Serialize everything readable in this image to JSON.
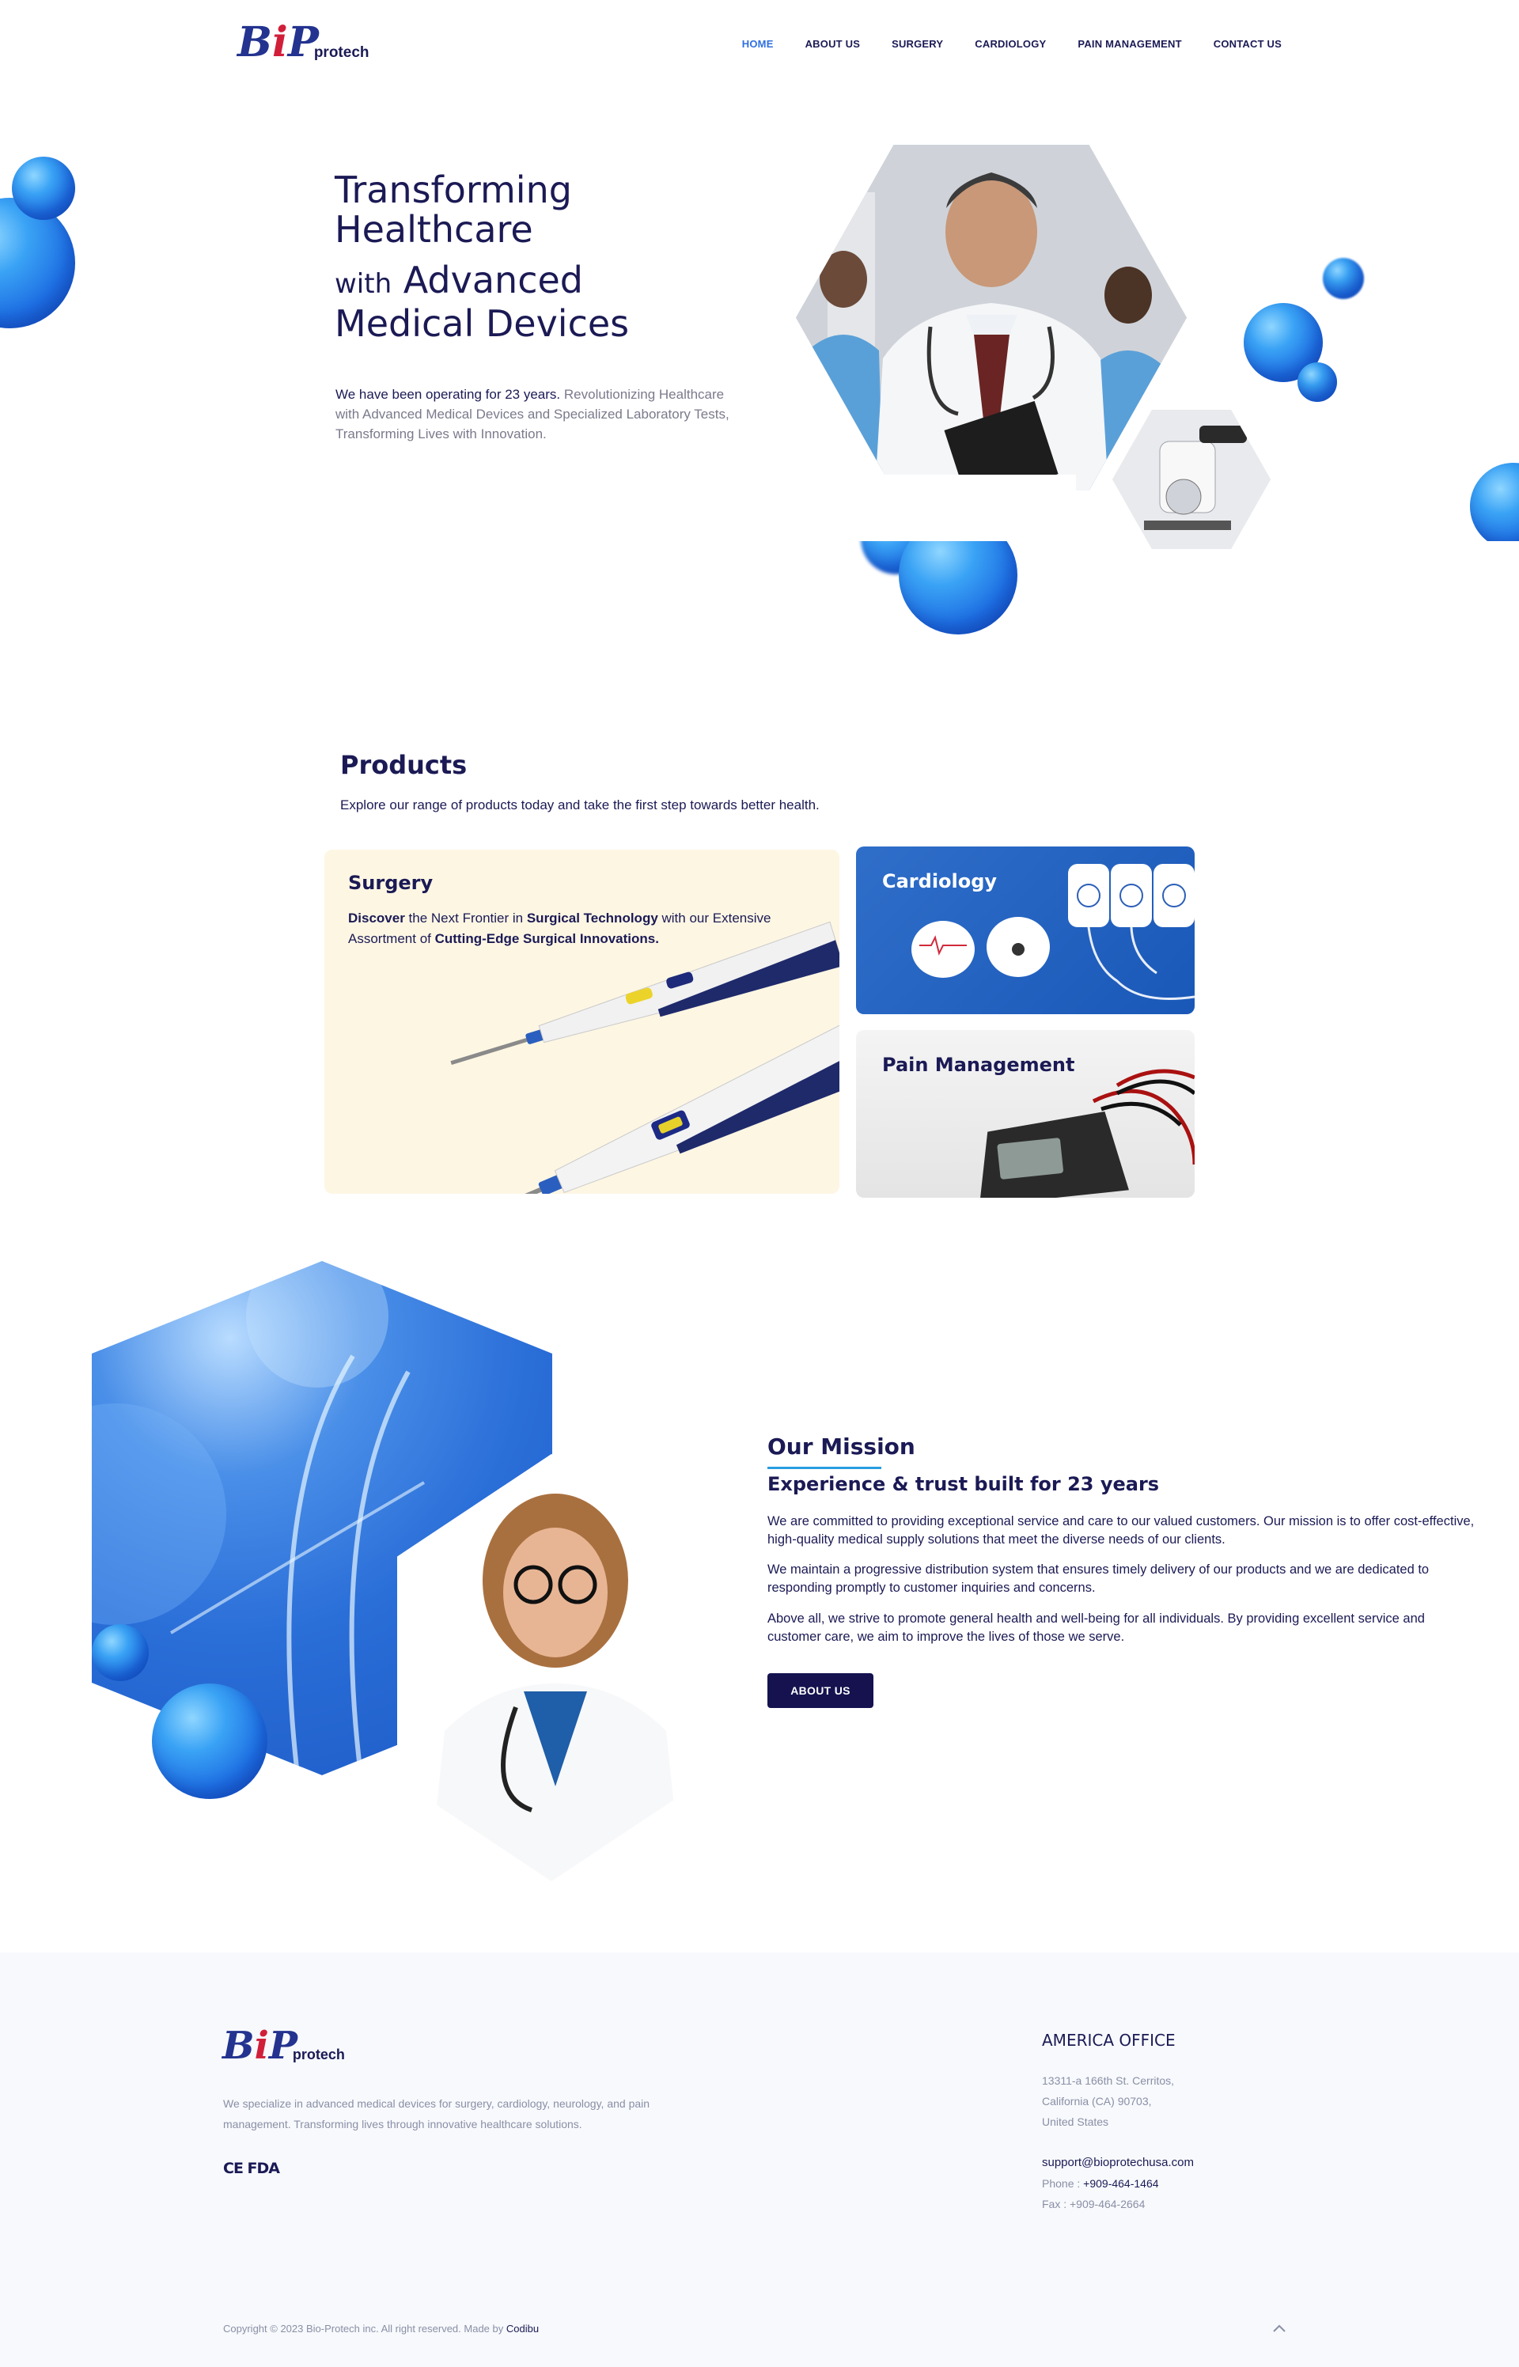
{
  "brand": {
    "mark_b": "B",
    "mark_o": "i",
    "mark_p": "P",
    "name": "protech"
  },
  "nav": [
    {
      "label": "HOME",
      "active": true
    },
    {
      "label": "ABOUT US",
      "active": false
    },
    {
      "label": "SURGERY",
      "active": false
    },
    {
      "label": "CARDIOLOGY",
      "active": false
    },
    {
      "label": "PAIN MANAGEMENT",
      "active": false
    },
    {
      "label": "CONTACT US",
      "active": false
    }
  ],
  "hero": {
    "title_line1": "Transforming",
    "title_line2": "Healthcare",
    "title_with": "with",
    "title_line3": "Advanced",
    "title_line4": "Medical Devices",
    "text_highlight": "We have been operating for 23 years.",
    "text_rest": "Revolutionizing Healthcare with Advanced Medical Devices and Specialized Laboratory Tests, Transforming Lives with Innovation."
  },
  "products": {
    "title": "Products",
    "subtitle": "Explore our range of products today and take the first step towards better health.",
    "surgery": {
      "title": "Surgery",
      "b1": "Discover",
      "t1": " the Next Frontier in ",
      "b2": "Surgical Technology",
      "t2": " with our Extensive Assortment of ",
      "b3": "Cutting-Edge Surgical Innovations."
    },
    "cardiology": {
      "title": "Cardiology"
    },
    "pain": {
      "title": "Pain Management"
    }
  },
  "mission": {
    "title": "Our Mission",
    "subtitle": "Experience & trust built for 23 years",
    "p1": "We are committed to providing exceptional service and care to our valued customers. Our mission is to offer cost-effective, high-quality medical supply solutions that meet the diverse needs of our clients.",
    "p2": "We maintain a progressive distribution system that ensures timely delivery of our products and we are dedicated to responding promptly to customer inquiries and concerns.",
    "p3": "Above all, we strive to promote general health and well-being for all individuals. By providing excellent service and customer care, we aim to improve the lives of those we serve.",
    "button": "ABOUT US"
  },
  "footer": {
    "description": "We specialize in advanced medical devices for surgery, cardiology, neurology, and pain management. Transforming lives through innovative healthcare solutions.",
    "cert": "CE FDA",
    "office_title": "AMERICA OFFICE",
    "address1": "13311-a 166th St. Cerritos,",
    "address2": "California (CA) 90703,",
    "address3": "United States",
    "email": "support@bioprotechusa.com",
    "phone_label": "Phone : ",
    "phone": "+909-464-1464",
    "fax": "Fax : +909-464-2664",
    "copyright": "Copyright © 2023 Bio-Protech inc. All right reserved. Made by ",
    "made_by": "Codibu",
    "scroll_top_icon": "chevron-up-icon"
  }
}
